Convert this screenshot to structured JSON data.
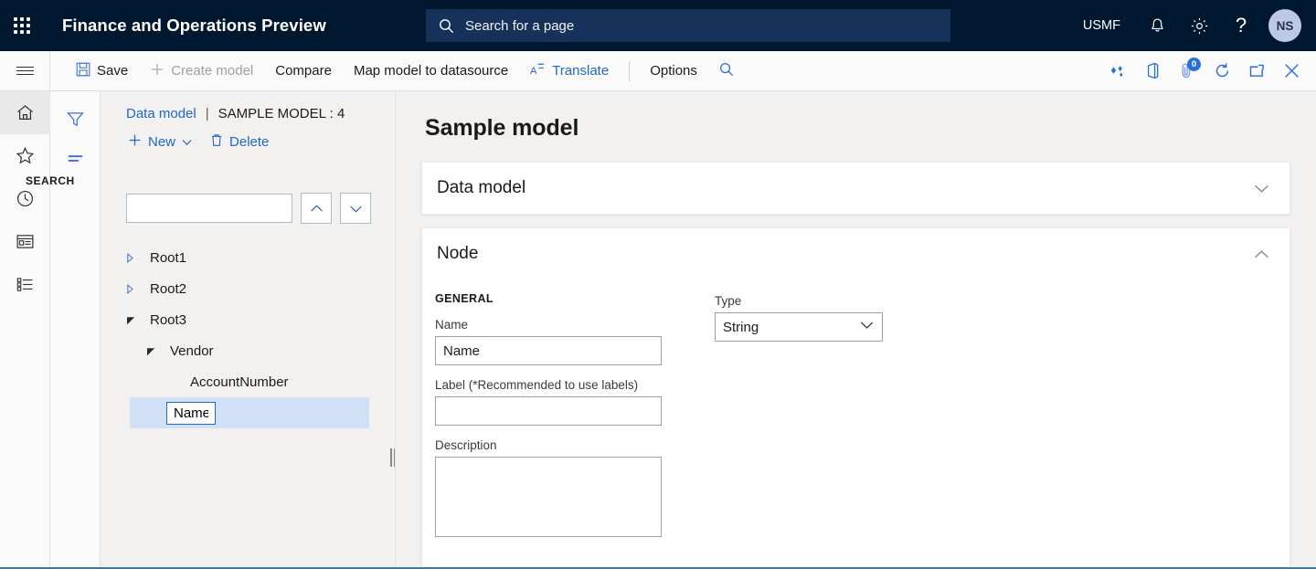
{
  "header": {
    "app_title": "Finance and Operations Preview",
    "waffle_icon": "app-launcher-icon",
    "search": {
      "placeholder": "Search for a page",
      "value": "",
      "icon": "search-icon"
    },
    "company": "USMF",
    "icons": [
      {
        "name": "notifications-bell-icon"
      },
      {
        "name": "settings-gear-icon"
      },
      {
        "name": "help-question-icon"
      }
    ],
    "help_glyph": "?",
    "avatar_initials": "NS",
    "background_color": "#00182F",
    "search_background_color": "#16315A",
    "avatar_color": "#BCC8E6"
  },
  "commandbar": {
    "hamburger_icon": "show-hide-navigation-pane-icon",
    "items": [
      {
        "label": "Save",
        "icon": "save-disk-icon",
        "state": "enabled"
      },
      {
        "label": "Create model",
        "icon": "plus-icon",
        "state": "disabled"
      },
      {
        "label": "Compare",
        "icon": "",
        "state": "enabled"
      },
      {
        "label": "Map model to datasource",
        "icon": "",
        "state": "enabled"
      },
      {
        "label": "Translate",
        "icon": "translate-icon",
        "state": "link"
      }
    ],
    "after_separator": [
      {
        "label": "Options",
        "icon": "",
        "state": "enabled"
      },
      {
        "label": "",
        "icon": "search-icon",
        "state": "enabled"
      }
    ],
    "right_icons": [
      {
        "name": "share-diamond-icon",
        "badge": ""
      },
      {
        "name": "office-app-icon",
        "badge": ""
      },
      {
        "name": "attachments-icon",
        "badge": "0"
      },
      {
        "name": "refresh-icon",
        "badge": ""
      },
      {
        "name": "popout-window-icon",
        "badge": ""
      },
      {
        "name": "close-icon",
        "badge": ""
      }
    ],
    "badge_count": "0",
    "accent_color": "#2B6FD4"
  },
  "navrail": {
    "items": [
      {
        "name": "sidebar-item-home",
        "icon": "home-icon",
        "active": true
      },
      {
        "name": "sidebar-item-favorites",
        "icon": "star-icon",
        "active": false
      },
      {
        "name": "sidebar-item-recent",
        "icon": "clock-recent-icon",
        "active": false
      },
      {
        "name": "sidebar-item-workspaces",
        "icon": "workspace-icon",
        "active": false
      },
      {
        "name": "sidebar-item-modules",
        "icon": "list-modules-icon",
        "active": false
      }
    ]
  },
  "toolrail": {
    "items": [
      {
        "name": "filter-tool",
        "icon": "filter-funnel-icon"
      },
      {
        "name": "lines-tool",
        "icon": "lines-list-icon"
      }
    ]
  },
  "leftpane": {
    "breadcrumb": {
      "link": "Data model",
      "separator": "|",
      "current": "SAMPLE MODEL : 4"
    },
    "commands": [
      {
        "label": "New",
        "icon": "plus-icon",
        "has_caret": true
      },
      {
        "label": "Delete",
        "icon": "trash-icon",
        "has_caret": false
      }
    ],
    "search_label": "SEARCH",
    "search_value": "",
    "search_placeholder": "",
    "prev_button_icon": "chevron-up-icon",
    "next_button_icon": "chevron-down-icon",
    "tree": [
      {
        "label": "Root1",
        "level": 0,
        "state": "collapsed",
        "selected": false,
        "editing": false
      },
      {
        "label": "Root2",
        "level": 0,
        "state": "collapsed",
        "selected": false,
        "editing": false
      },
      {
        "label": "Root3",
        "level": 0,
        "state": "expanded",
        "selected": false,
        "editing": false
      },
      {
        "label": "Vendor",
        "level": 1,
        "state": "expanded",
        "selected": false,
        "editing": false
      },
      {
        "label": "AccountNumber",
        "level": 2,
        "state": "leaf",
        "selected": false,
        "editing": false
      },
      {
        "label": "Name",
        "level": 2,
        "state": "leaf",
        "selected": true,
        "editing": true
      }
    ],
    "selection_color": "#CFE0F7",
    "splitter_name": "pane-resize-handle"
  },
  "content": {
    "page_title": "Sample model",
    "cards": [
      {
        "title": "Data model",
        "expanded": false,
        "chevron": "chevron-down-icon"
      },
      {
        "title": "Node",
        "expanded": true,
        "chevron": "chevron-up-icon"
      }
    ],
    "node_form": {
      "section_header": "GENERAL",
      "name_label": "Name",
      "name_value": "Name",
      "label_label": "Label (*Recommended to use labels)",
      "label_value": "",
      "description_label": "Description",
      "description_value": "",
      "type_label": "Type",
      "type_value": "String",
      "type_options": [
        "String"
      ]
    }
  }
}
